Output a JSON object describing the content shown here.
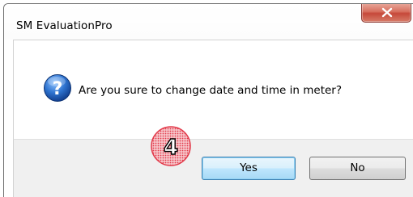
{
  "window": {
    "title": "SM EvaluationPro",
    "close_icon": "close-x-icon"
  },
  "dialog": {
    "icon": "question-icon",
    "message": "Are you sure to change date and time in meter?"
  },
  "buttons": {
    "yes_label": "Yes",
    "no_label": "No"
  },
  "annotation": {
    "step_number": "4",
    "marker_color": "#e23a4a"
  },
  "colors": {
    "close_button": "#c6493a",
    "question_icon": "#1f5fb8",
    "footer_background": "#f0f0f0",
    "default_button_border": "#3c7fb1"
  }
}
